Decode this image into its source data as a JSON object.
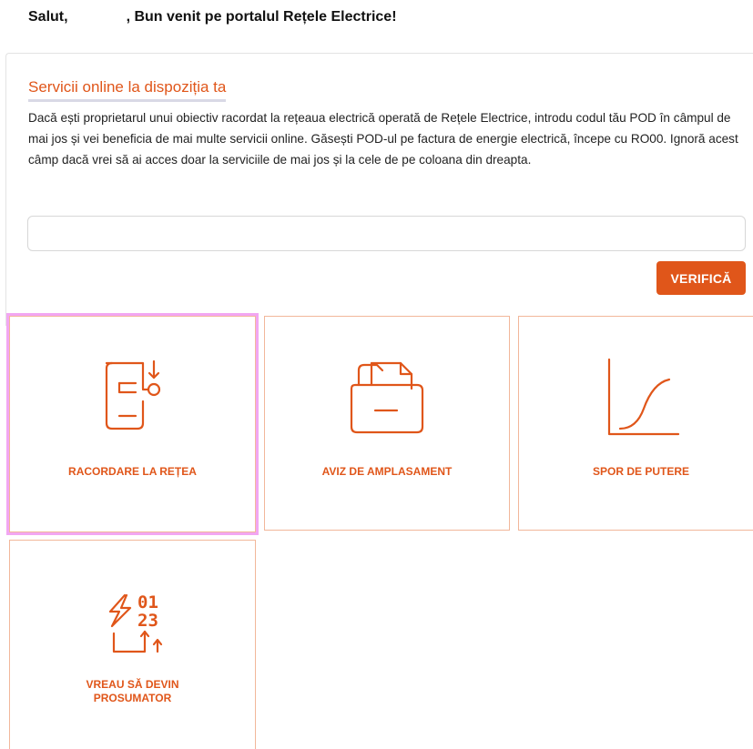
{
  "header": {
    "greeting_prefix": "Salut,",
    "greeting_suffix": ", Bun venit pe portalul Rețele Electrice!"
  },
  "section": {
    "title": "Servicii online la dispoziția ta",
    "intro": "Dacă ești proprietarul unui obiectiv racordat la rețeaua electrică operată de Rețele Electrice, introdu codul tău POD în câmpul de mai jos și vei beneficia de mai multe servicii online. Găsești POD-ul pe factura de energie electrică, începe cu RO00. Ignoră acest câmp dacă vrei să ai acces doar la serviciile de mai jos și la cele de pe coloana din dreapta."
  },
  "pod_form": {
    "input_value": "",
    "input_placeholder": "",
    "verify_label": "VERIFICĂ"
  },
  "services": [
    {
      "label": "RACORDARE LA REȚEA",
      "icon": "document-connection-icon",
      "selected": true
    },
    {
      "label": "AVIZ DE AMPLASAMENT",
      "icon": "folder-document-icon",
      "selected": false
    },
    {
      "label": "SPOR DE PUTERE",
      "icon": "growth-curve-icon",
      "selected": false
    },
    {
      "label": "VREAU SĂ DEVIN PROSUMATOR",
      "icon": "prosumer-energy-icon",
      "selected": false
    }
  ],
  "prosumer_icon_digits": {
    "top": "01",
    "bottom": "23"
  },
  "colors": {
    "accent": "#e0561a",
    "card_border": "#f2b79a",
    "selected_outline": "#f2a6f2",
    "title_underline": "#d9d9e6"
  }
}
